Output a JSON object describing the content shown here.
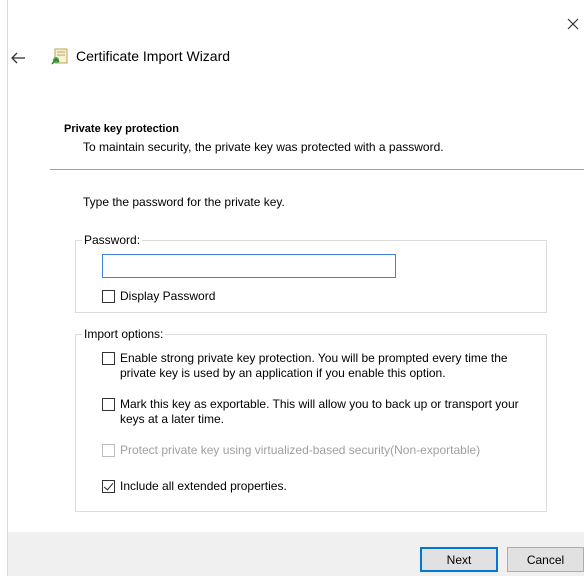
{
  "window": {
    "title": "Certificate Import Wizard",
    "accent_color": "#0078d7"
  },
  "page": {
    "heading": "Private key protection",
    "description": "To maintain security, the private key was protected with a password.",
    "instruction": "Type the password for the private key."
  },
  "password_group": {
    "legend": "Password:",
    "value": "",
    "display_password_label": "Display Password",
    "display_password_checked": false
  },
  "import_options": {
    "legend": "Import options:",
    "options": [
      {
        "label_line1": "Enable strong private key protection. You will be prompted every time the",
        "label_line2": "private key is used by an application if you enable this option.",
        "checked": false,
        "disabled": false
      },
      {
        "label_line1": "Mark this key as exportable. This will allow you to back up or transport your",
        "label_line2": "keys at a later time.",
        "checked": false,
        "disabled": false
      },
      {
        "label_line1": "Protect private key using virtualized-based security(Non-exportable)",
        "label_line2": "",
        "checked": false,
        "disabled": true
      },
      {
        "label_line1": "Include all extended properties.",
        "label_line2": "",
        "checked": true,
        "disabled": false
      }
    ]
  },
  "buttons": {
    "next": "Next",
    "cancel": "Cancel"
  },
  "icons": {
    "close": "close-icon",
    "back": "back-arrow-icon",
    "wizard": "certificate-icon"
  }
}
